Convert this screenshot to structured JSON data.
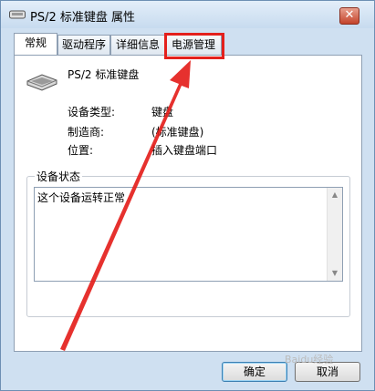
{
  "window": {
    "title": "PS/2 标准键盘 属性",
    "close_glyph": "✕"
  },
  "tabs": [
    {
      "label": "常规",
      "active": true
    },
    {
      "label": "驱动程序",
      "active": false
    },
    {
      "label": "详细信息",
      "active": false
    },
    {
      "label": "电源管理",
      "active": false,
      "highlighted": true
    }
  ],
  "device": {
    "name": "PS/2 标准键盘",
    "icon": "keyboard-icon",
    "properties": [
      {
        "label": "设备类型:",
        "value": "键盘"
      },
      {
        "label": "制造商:",
        "value": "(标准键盘)"
      },
      {
        "label": "位置:",
        "value": "插入键盘端口"
      }
    ]
  },
  "status": {
    "legend": "设备状态",
    "text": "这个设备运转正常"
  },
  "buttons": {
    "ok": "确定",
    "cancel": "取消"
  },
  "annotation": {
    "color": "#e4201c"
  },
  "watermark": "Baidu经验"
}
